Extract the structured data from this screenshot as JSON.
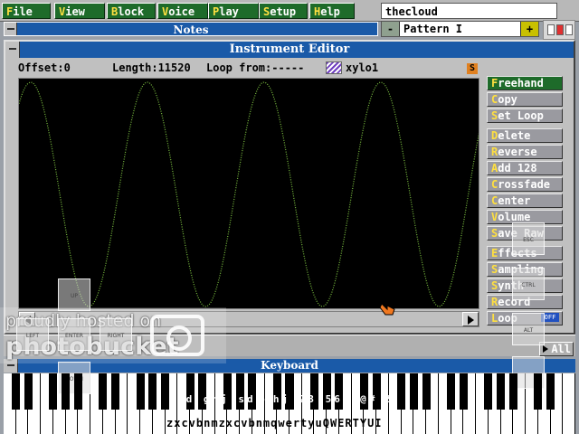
{
  "menu": [
    {
      "hk": "F",
      "rest": "ile"
    },
    {
      "hk": "V",
      "rest": "iew"
    },
    {
      "hk": "B",
      "rest": "lock"
    },
    {
      "hk": "V",
      "rest": "oice"
    },
    {
      "hk": "P",
      "rest": "lay"
    },
    {
      "hk": "S",
      "rest": "etup"
    },
    {
      "hk": "H",
      "rest": "elp"
    }
  ],
  "song": {
    "name": "thecloud",
    "pattern": "Pattern I",
    "minus": "-",
    "plus": "+"
  },
  "notes": {
    "title": "Notes"
  },
  "editor": {
    "title": "Instrument Editor",
    "offset": "Offset:0",
    "length": "Length:11520",
    "loop_from": "Loop from:-----",
    "instrument": "xylo1",
    "s_badge": "S",
    "wave_color": "#7cc040"
  },
  "buttons": [
    {
      "hk": "F",
      "rest": "reehand",
      "active": true
    },
    {
      "hk": "C",
      "rest": "opy"
    },
    {
      "hk": "S",
      "rest": "et Loop"
    },
    {
      "hk": "D",
      "rest": "elete"
    },
    {
      "hk": "R",
      "rest": "everse"
    },
    {
      "hk": "A",
      "rest": "dd 128"
    },
    {
      "hk": "C",
      "rest": "rossfade"
    },
    {
      "hk": "C",
      "rest": "enter"
    },
    {
      "hk": "V",
      "rest": "olume"
    },
    {
      "hk": "S",
      "rest": "ave Raw"
    },
    {
      "hk": "E",
      "rest": "ffects"
    },
    {
      "hk": "S",
      "rest": "ampling"
    },
    {
      "hk": "S",
      "rest": "ynth"
    },
    {
      "hk": "R",
      "rest": "ecord"
    },
    {
      "hk": "L",
      "rest": "oop"
    }
  ],
  "off_badge": "OFF",
  "all_button": "All",
  "keyboard": {
    "title": "Keyboard",
    "lower_keys": "zxcvbnmzxcvbnmqwertyuQWERTYUI",
    "upper_keys": "sd ghj sd ghj 23 567 @# &"
  },
  "touch": {
    "up": "UP",
    "left": "LEFT",
    "enter": "ENTER",
    "right": "RIGHT",
    "down": "DOWN",
    "esc": "ESC",
    "ctrl": "CTRL",
    "alt": "ALT"
  },
  "watermark": {
    "line1": "proudly hosted on",
    "line2": "photobucket"
  }
}
